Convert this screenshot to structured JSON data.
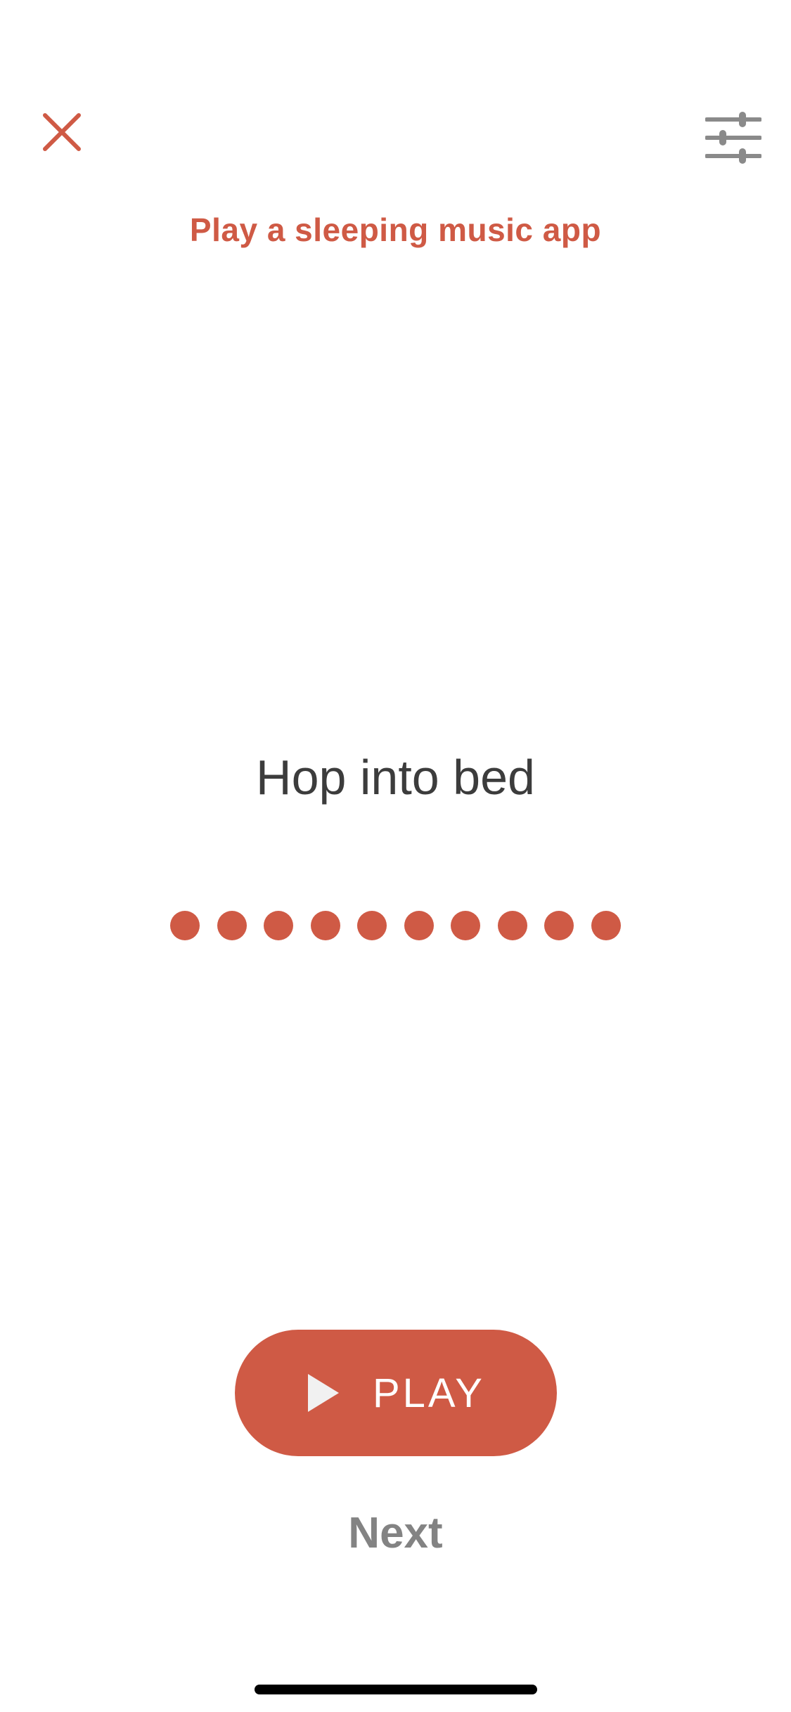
{
  "header": {
    "title": "Play a sleeping music app",
    "close_icon": "close-icon",
    "settings_icon": "sliders-icon"
  },
  "step": {
    "text": "Hop into bed",
    "dot_count": 10
  },
  "actions": {
    "play_label": "PLAY",
    "play_icon": "play-icon",
    "next_label": "Next"
  },
  "colors": {
    "accent": "#cf5a45",
    "text_dark": "#3c3c3c",
    "text_muted": "#838383",
    "icon_gray": "#8a8a8a",
    "background": "#ffffff"
  }
}
